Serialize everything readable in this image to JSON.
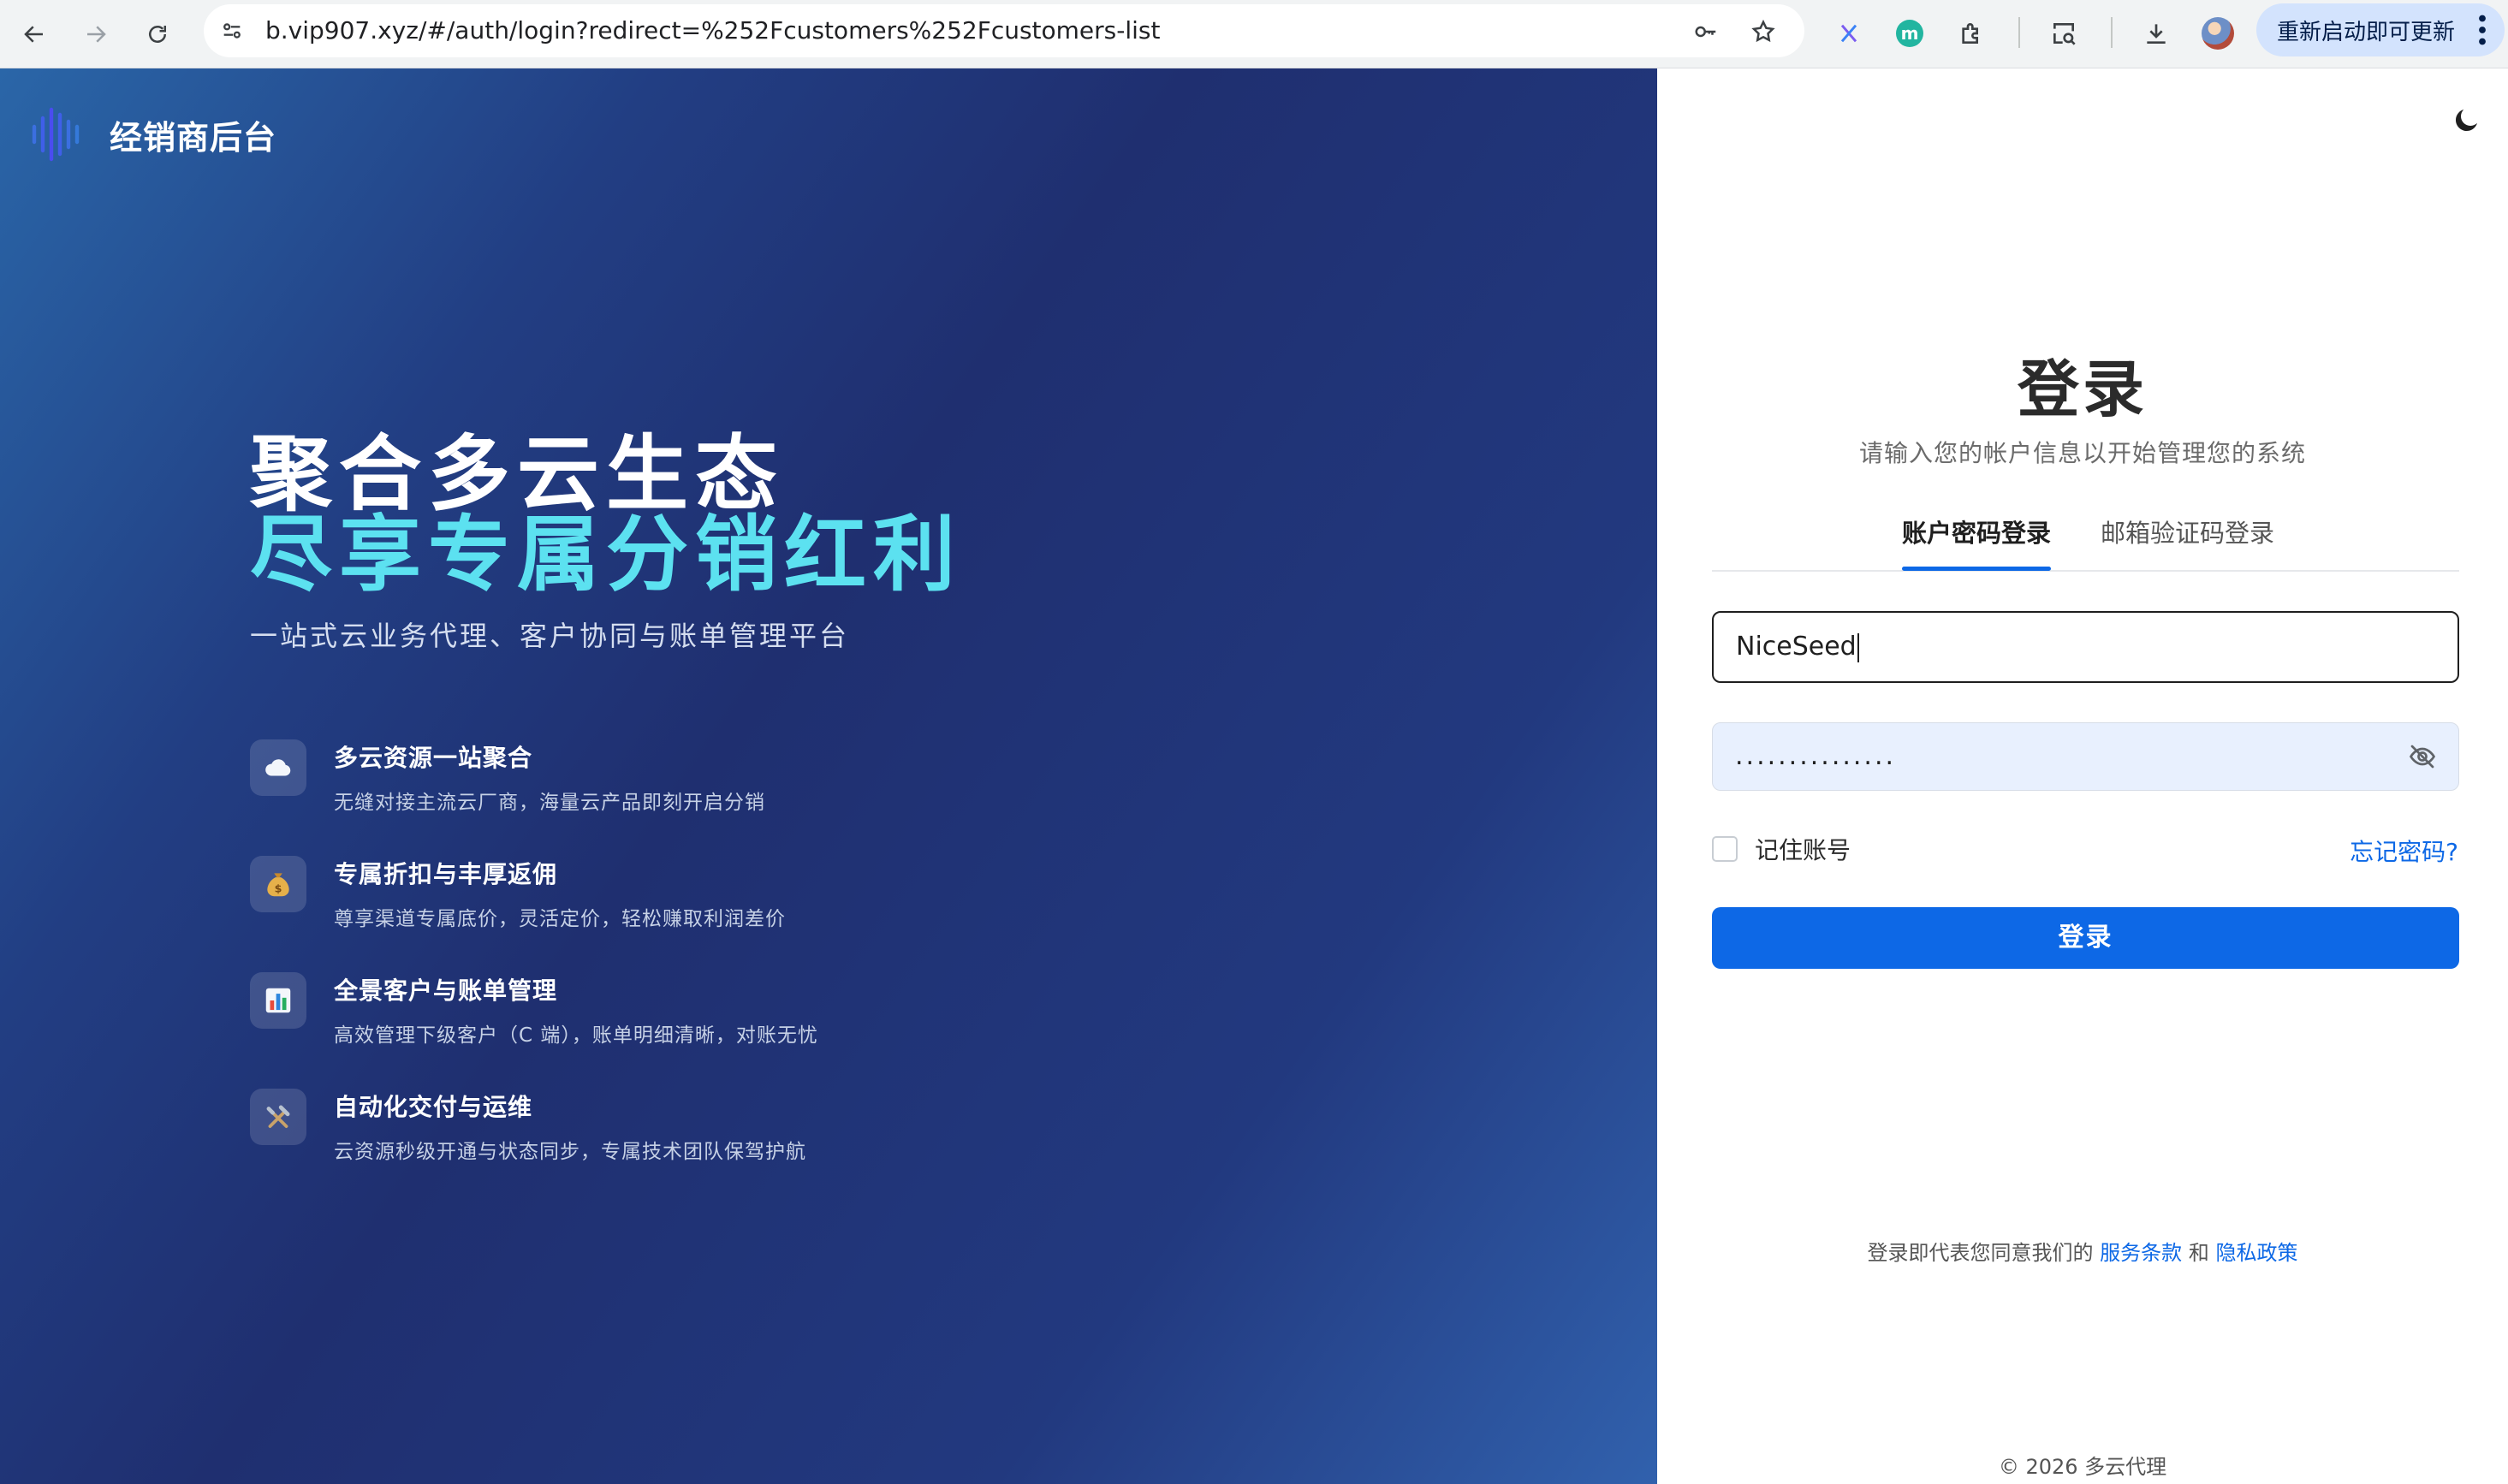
{
  "browser": {
    "url": "b.vip907.xyz/#/auth/login?redirect=%252Fcustomers%252Fcustomers-list",
    "update_label": "重新启动即可更新"
  },
  "brand": {
    "name": "经销商后台"
  },
  "hero": {
    "headline_line1": "聚合多云生态",
    "headline_line2": "尽享专属分销红利",
    "subline": "一站式云业务代理、客户协同与账单管理平台",
    "features": [
      {
        "icon": "cloud-icon",
        "title": "多云资源一站聚合",
        "desc": "无缝对接主流云厂商，海量云产品即刻开启分销"
      },
      {
        "icon": "money-bag-icon",
        "title": "专属折扣与丰厚返佣",
        "desc": "尊享渠道专属底价，灵活定价，轻松赚取利润差价"
      },
      {
        "icon": "bar-chart-icon",
        "title": "全景客户与账单管理",
        "desc": "高效管理下级客户（C 端），账单明细清晰，对账无忧"
      },
      {
        "icon": "tools-icon",
        "title": "自动化交付与运维",
        "desc": "云资源秒级开通与状态同步，专属技术团队保驾护航"
      }
    ],
    "colors": {
      "accent": "#5ce1f0",
      "gradient_start": "#2a66a8",
      "gradient_end": "#3161ad"
    }
  },
  "login": {
    "title": "登录",
    "subtitle": "请输入您的帐户信息以开始管理您的系统",
    "tabs": [
      {
        "label": "账户密码登录",
        "active": true
      },
      {
        "label": "邮箱验证码登录",
        "active": false
      }
    ],
    "username_value": "NiceSeed",
    "password_masked": "...............",
    "remember_label": "记住账号",
    "remember_checked": false,
    "forgot_label": "忘记密码?",
    "submit_label": "登录",
    "agree_prefix": "登录即代表您同意我们的",
    "terms_label": "服务条款",
    "and_label": "和",
    "privacy_label": "隐私政策",
    "copyright": "© 2026 多云代理",
    "colors": {
      "primary": "#0d68e6"
    }
  }
}
